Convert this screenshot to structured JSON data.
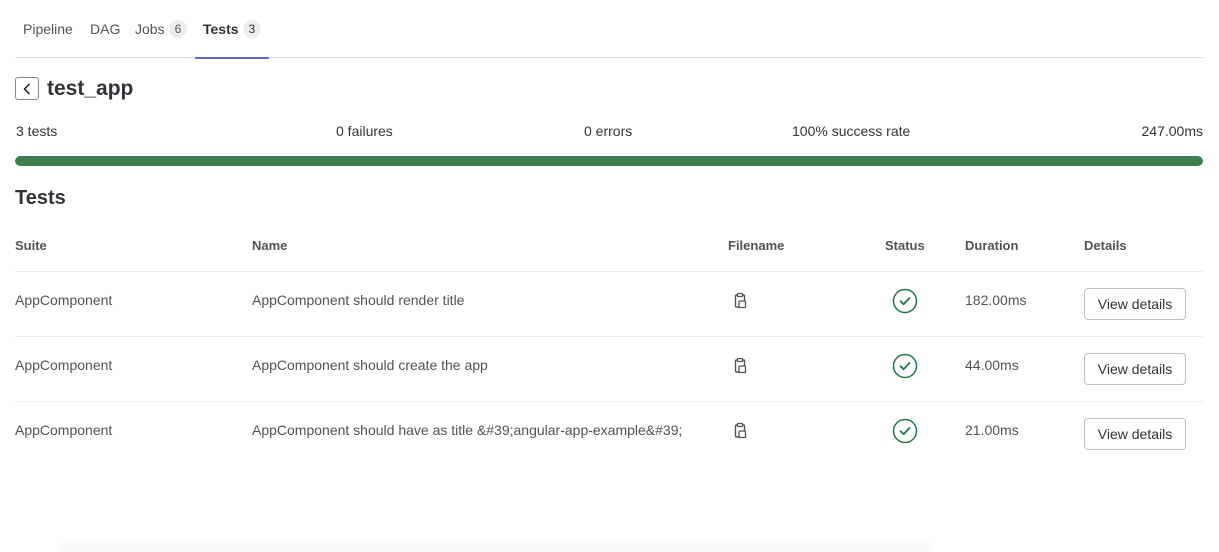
{
  "tabs": [
    {
      "label": "Pipeline",
      "count": null
    },
    {
      "label": "DAG",
      "count": null
    },
    {
      "label": "Jobs",
      "count": "6"
    },
    {
      "label": "Tests",
      "count": "3",
      "active": true
    }
  ],
  "header": {
    "title": "test_app"
  },
  "summary": {
    "tests": "3 tests",
    "failures": "0 failures",
    "errors": "0 errors",
    "success_rate": "100% success rate",
    "duration": "247.00ms",
    "success_fraction": 1.0
  },
  "section_title": "Tests",
  "table": {
    "headers": {
      "suite": "Suite",
      "name": "Name",
      "filename": "Filename",
      "status": "Status",
      "duration": "Duration",
      "details": "Details"
    },
    "rows": [
      {
        "suite": "AppComponent",
        "name": "AppComponent should render title",
        "status": "success",
        "duration": "182.00ms",
        "details_label": "View details"
      },
      {
        "suite": "AppComponent",
        "name": "AppComponent should create the app",
        "status": "success",
        "duration": "44.00ms",
        "details_label": "View details"
      },
      {
        "suite": "AppComponent",
        "name": "AppComponent should have as title &#39;angular-app-example&#39;",
        "status": "success",
        "duration": "21.00ms",
        "details_label": "View details"
      }
    ]
  },
  "colors": {
    "success": "#217645",
    "progress": "#3e7d4e",
    "tab_underline": "#6666c4"
  },
  "icons": {
    "back": "chevron-left-icon",
    "copy": "copy-to-clipboard-icon",
    "status": "status-success-icon"
  }
}
